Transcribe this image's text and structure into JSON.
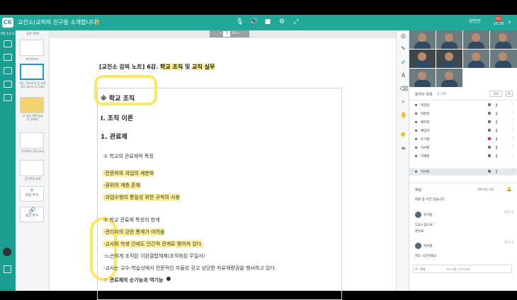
{
  "app": {
    "logo": "CK",
    "title": "교친소(교직의 친구들 소개합니다)",
    "lock_icon": "lock-icon",
    "user": "양연관",
    "rec": "REC",
    "rec_time": "10:30"
  },
  "left": {
    "time": "00:12:17",
    "icons": [
      "chat-icon",
      "screen-icon",
      "document-icon",
      "video-icon",
      "people-icon"
    ]
  },
  "thumbs": {
    "header": "공유 파일",
    "captions": [
      "화이트보드",
      "4강, 학교조직 및 교직 실무.docx (1.1kb)",
      "교 공유 화면.jpg (1.10kb)",
      "판서파일 공유.png",
      "강의목차.pdf"
    ],
    "add_file": "파일 추가",
    "add_link": "링크 추가"
  },
  "stage": {
    "page_current": "1",
    "page_total": "16",
    "title_prefix": "[교친소 강의 노트]",
    "title_main": "6강.",
    "title_highlight1": "학교 조직",
    "title_and": "및",
    "title_highlight2": "교직 실무",
    "section1": "※ 학교 조직",
    "section2": "Ⅰ. 조직 이론",
    "section3": "1. 관료제",
    "item1": "① 학교의 관료제적 특징",
    "item2": "-전문화와 과업의 세분화",
    "item3": "-권위의 계층 존재",
    "item4": "-과업수행의 통일성 위한 규칙의 사용",
    "item5": "② 학교 관료제 특성의 한계",
    "item6": "-관리자의 강한 통제가 어려움",
    "item7": "-교사와 학생 간에도 인간적 관계로 맺어져 있다.",
    "item8": "-느슨하게 조직된 이완결합체제(조직화된 무질서)",
    "item9": "-교사는 교수-학습상에서 전문적인 자율성 갖고 상당한 자유재량권을 행사하고 있다.",
    "item10": "☆ 관료제의 순기능과 역기능"
  },
  "tools": [
    "target-icon",
    "pen-icon",
    "highlighter-icon",
    "text-icon",
    "eraser-icon",
    "search-icon",
    "hand-icon",
    "color-icon",
    "menu-icon"
  ],
  "participants": {
    "title": "참여자 목록",
    "count": "6 / 50",
    "select": "전체",
    "close_label": "×",
    "names": [
      "박정민",
      "박정현",
      "배지희",
      "채민아",
      "유가흠",
      "지서영",
      "지재원",
      "지서희"
    ],
    "more_icon": "⋮"
  },
  "chat": {
    "title": "채팅",
    "clear": "대화내용 저장",
    "icon": "bell-icon",
    "messages": [
      {
        "name": "",
        "time": "",
        "text": "회원 중 기간 있습니다"
      },
      {
        "name": "유가흠",
        "time": "10:13",
        "text": "1교시 듣나요"
      },
      {
        "name": "",
        "time": "",
        "text": "끝이요"
      },
      {
        "name": "지서영",
        "time": "10:13",
        "text": "저도 시간이에요"
      }
    ],
    "input_select": "전체",
    "input_placeholder": "메시지를 입력하세요"
  },
  "colors": {
    "teal": "#22a899",
    "blue": "#1b97d4",
    "yellow": "#f7c000"
  }
}
